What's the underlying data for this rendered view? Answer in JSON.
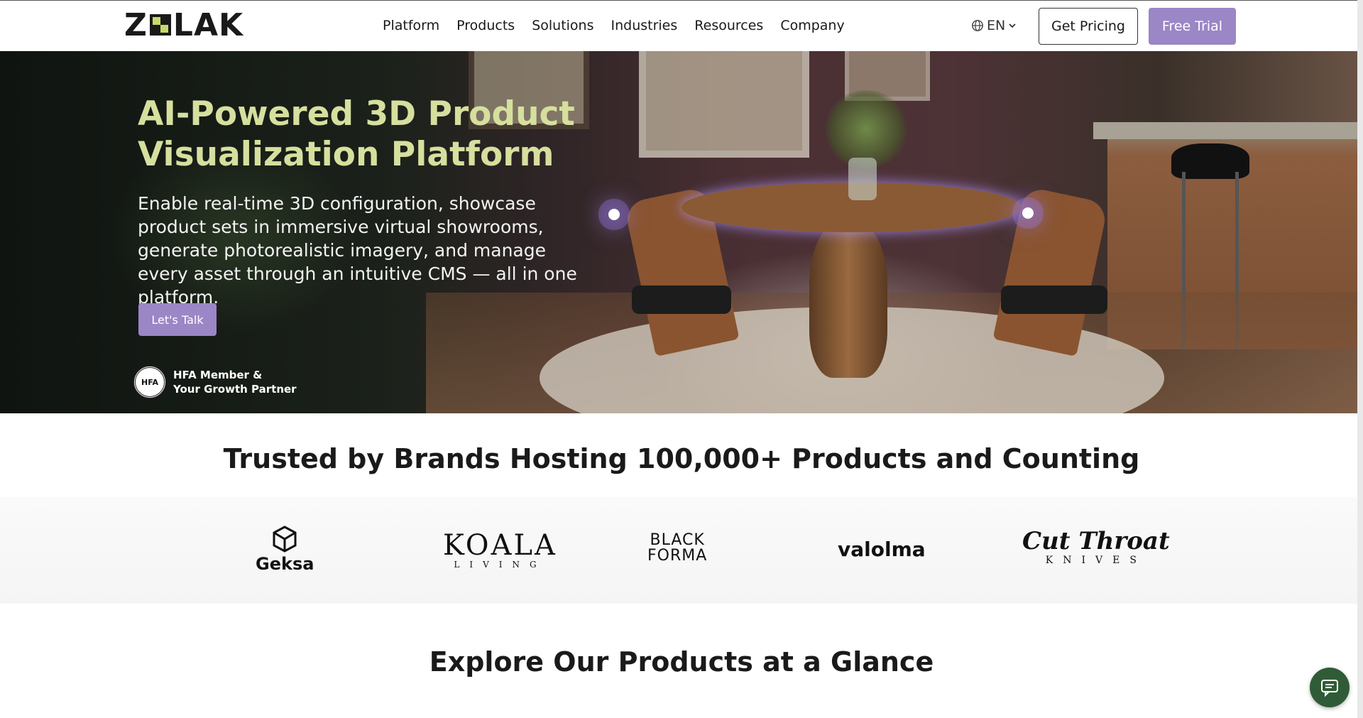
{
  "nav": {
    "logo_text": "ZOLAK",
    "menu": [
      "Platform",
      "Products",
      "Solutions",
      "Industries",
      "Resources",
      "Company"
    ],
    "language": "EN",
    "get_pricing": "Get Pricing",
    "free_trial": "Free Trial"
  },
  "hero": {
    "title": "AI-Powered 3D Product Visualization Platform",
    "description": "Enable real-time 3D configuration, showcase product sets in immersive virtual showrooms, generate photorealistic imagery, and manage every asset through an intuitive CMS — all in one platform.",
    "cta": "Let's Talk",
    "badge_line1": "HFA Member &",
    "badge_line2": "Your Growth Partner",
    "badge_seal": "HFA"
  },
  "trusted": {
    "heading": "Trusted by Brands Hosting 100,000+ Products and Counting",
    "brands": [
      {
        "name": "Geksa"
      },
      {
        "name": "KOALA",
        "sub": "LIVING"
      },
      {
        "name": "BLACK",
        "sub": "FORMA"
      },
      {
        "name": "valolma"
      },
      {
        "name": "Cut Throat",
        "sub": "KNIVES"
      }
    ]
  },
  "explore": {
    "heading": "Explore Our Products at a Glance"
  },
  "colors": {
    "accent": "#9b86c6",
    "title_green": "#d6df9e",
    "chat_green": "#2f5c36"
  }
}
